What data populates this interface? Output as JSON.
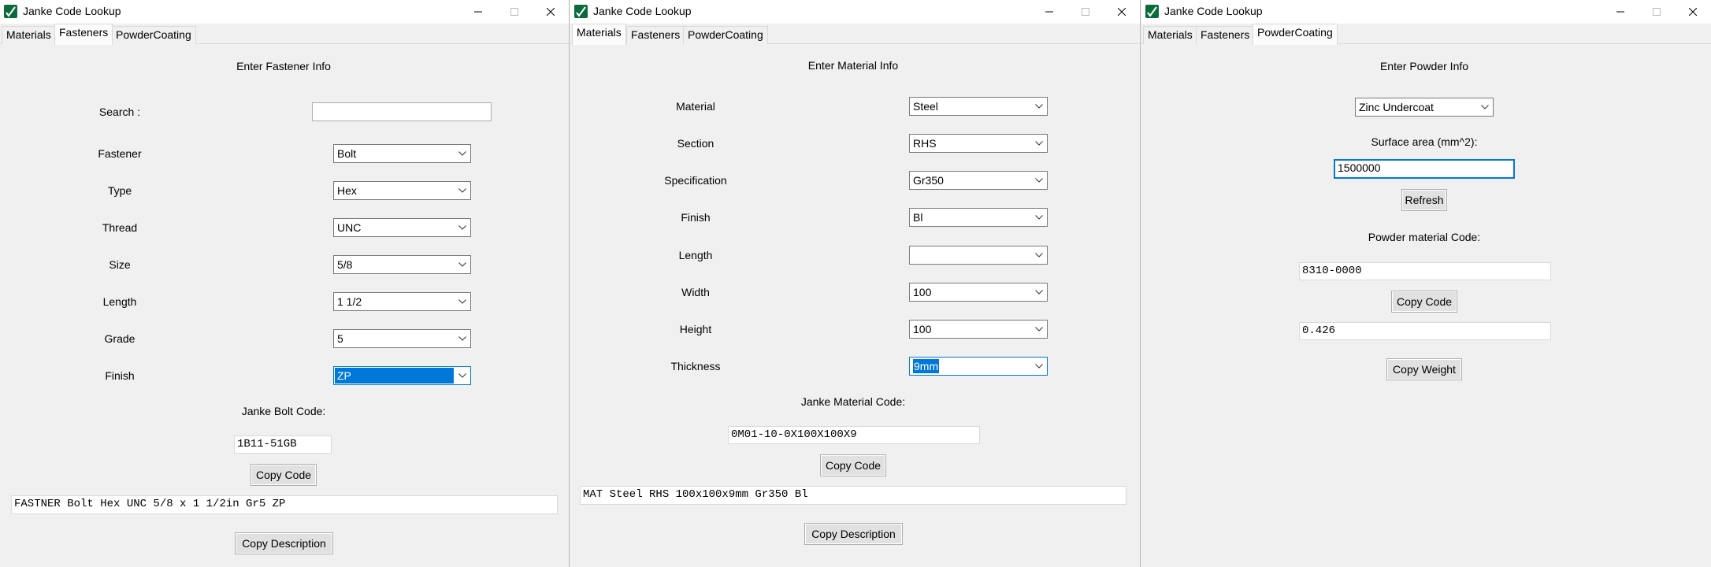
{
  "app": {
    "title": "Janke Code Lookup",
    "tabs": [
      "Materials",
      "Fasteners",
      "PowderCoating"
    ],
    "accent": "#0078d7"
  },
  "fasteners": {
    "heading": "Enter Fastener Info",
    "search_label": "Search :",
    "search_value": "",
    "fields": [
      {
        "label": "Fastener",
        "value": "Bolt"
      },
      {
        "label": "Type",
        "value": "Hex"
      },
      {
        "label": "Thread",
        "value": "UNC"
      },
      {
        "label": "Size",
        "value": "5/8"
      },
      {
        "label": "Length",
        "value": "1 1/2"
      },
      {
        "label": "Grade",
        "value": "5"
      },
      {
        "label": "Finish",
        "value": "ZP"
      }
    ],
    "code_label": "Janke Bolt Code:",
    "code_value": "1B11-51GB",
    "copy_code": "Copy Code",
    "description": "FASTNER Bolt Hex UNC 5/8 x 1 1/2in Gr5 ZP",
    "copy_description": "Copy Description"
  },
  "materials": {
    "heading": "Enter Material Info",
    "fields": [
      {
        "label": "Material",
        "value": "Steel"
      },
      {
        "label": "Section",
        "value": "RHS"
      },
      {
        "label": "Specification",
        "value": "Gr350"
      },
      {
        "label": "Finish",
        "value": "Bl"
      },
      {
        "label": "Length",
        "value": ""
      },
      {
        "label": "Width",
        "value": "100"
      },
      {
        "label": "Height",
        "value": "100"
      },
      {
        "label": "Thickness",
        "value": "9mm"
      }
    ],
    "code_label": "Janke Material Code:",
    "code_value": "0M01-10-0X100X100X9",
    "copy_code": "Copy Code",
    "description": "MAT Steel RHS 100x100x9mm Gr350 Bl",
    "copy_description": "Copy Description"
  },
  "powder": {
    "heading": "Enter Powder Info",
    "powder_type": "Zinc Undercoat",
    "surface_label": "Surface area (mm^2):",
    "surface_value": "1500000",
    "refresh": "Refresh",
    "code_label": "Powder material Code:",
    "code_value": "8310-0000",
    "copy_code": "Copy Code",
    "weight_value": "0.426",
    "copy_weight": "Copy Weight"
  }
}
